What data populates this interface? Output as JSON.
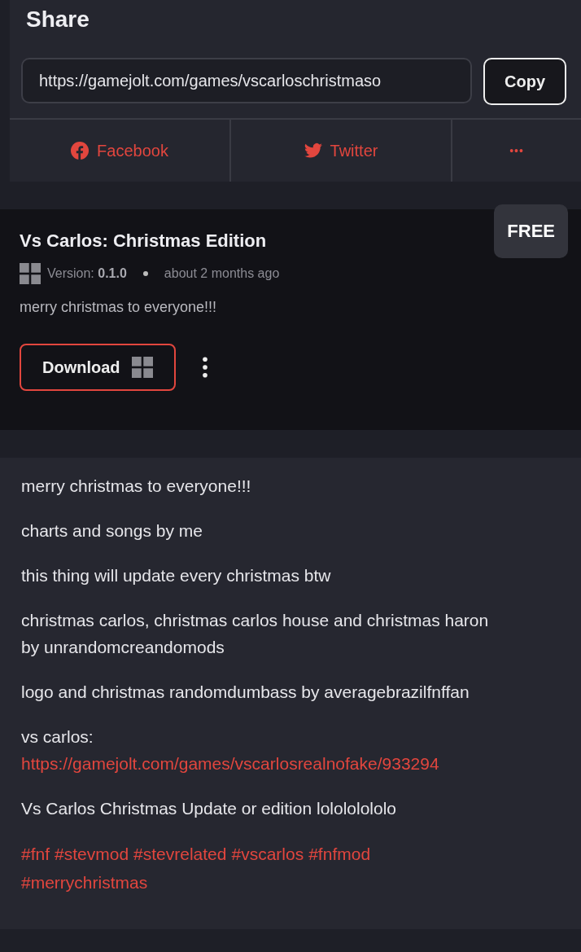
{
  "share": {
    "title": "Share",
    "url": "https://gamejolt.com/games/vscarloschristmaso",
    "copy_label": "Copy",
    "buttons": [
      {
        "kind": "facebook",
        "label": "Facebook"
      },
      {
        "kind": "twitter",
        "label": "Twitter"
      },
      {
        "kind": "more",
        "label": "•••"
      }
    ]
  },
  "build": {
    "title": "Vs Carlos: Christmas Edition",
    "price": "FREE",
    "version_label": "Version:",
    "version": "0.1.0",
    "time": "about 2 months ago",
    "note": "merry christmas to everyone!!!",
    "download_label": "Download"
  },
  "description": [
    {
      "kind": "text",
      "text": "merry christmas to everyone!!!"
    },
    {
      "kind": "text",
      "text": "charts and songs by me"
    },
    {
      "kind": "text",
      "text": "this thing will update every christmas btw"
    },
    {
      "kind": "text",
      "text": "christmas carlos, christmas carlos house and christmas haron by unrandomcreandomods"
    },
    {
      "kind": "text",
      "text": "logo and christmas randomdumbass by averagebrazilfnffan"
    },
    {
      "kind": "link",
      "text": "vs carlos:",
      "link": "https://gamejolt.com/games/vscarlosrealnofake/933294"
    },
    {
      "kind": "text",
      "text": "Vs Carlos Christmas Update or edition lolololololo"
    },
    {
      "kind": "tags",
      "tags": [
        "#fnf",
        "#stevmod",
        "#stevrelated",
        "#vscarlos",
        "#fnfmod",
        "#merrychristmas"
      ]
    }
  ]
}
